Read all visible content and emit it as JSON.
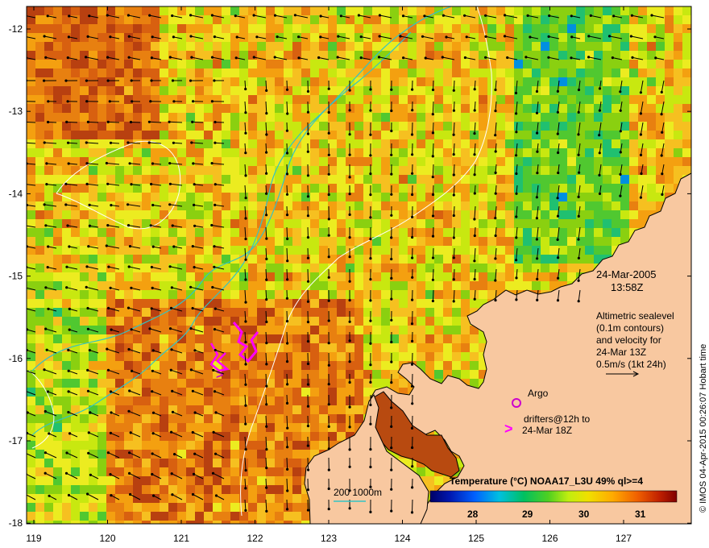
{
  "map": {
    "xticks": [
      "119",
      "120",
      "121",
      "122",
      "123",
      "124",
      "125",
      "126",
      "127"
    ],
    "yticks": [
      "-12",
      "-13",
      "-14",
      "-15",
      "-16",
      "-17",
      "-18"
    ]
  },
  "annotations": {
    "date": "24-Mar-2005",
    "time": "13:58Z",
    "altimetry_1": "Altimetric sealevel",
    "altimetry_2": "(0.1m contours)",
    "altimetry_3": "and velocity for",
    "altimetry_4": "24-Mar 13Z",
    "altimetry_5": "0.5m/s (1kt 24h)",
    "argo": "Argo",
    "drifters_1": "drifters@12h to",
    "drifters_2": "24-Mar 18Z",
    "scale_bar": "200  1000m"
  },
  "colorbar": {
    "title": "Temperature (°C) NOAA17_L3U 49% ql>=4",
    "ticks": [
      "28",
      "29",
      "30",
      "31"
    ]
  },
  "credit": "© IMOS 04-Apr-2015 00:26:07 Hobart time",
  "colors": {
    "land": "#f8c8a0",
    "contour": "#ffffff",
    "isobath": "#33c4c4",
    "drifter": "#ff00ff",
    "argo": "#cc00cc"
  }
}
